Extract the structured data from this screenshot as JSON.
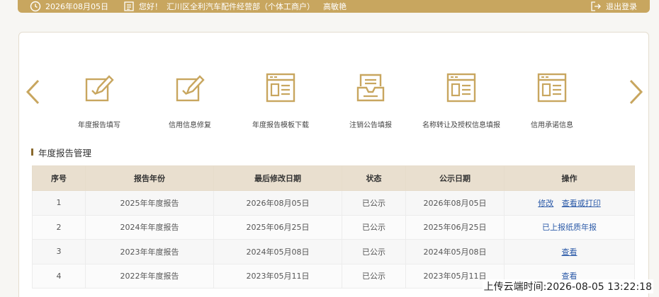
{
  "header": {
    "date": "2026年08月05日",
    "greeting": "您好！",
    "company": "汇川区全利汽车配件经营部（个体工商户）",
    "user": "高敏艳",
    "logout_label": "退出登录"
  },
  "functions": [
    {
      "label": "年度报告填写",
      "icon": "report-edit-icon"
    },
    {
      "label": "信用信息修复",
      "icon": "credit-repair-icon"
    },
    {
      "label": "年度报告模板下载",
      "icon": "template-download-icon"
    },
    {
      "label": "注销公告填报",
      "icon": "cancel-notice-icon"
    },
    {
      "label": "名称转让及授权信息填报",
      "icon": "name-transfer-icon"
    },
    {
      "label": "信用承诺信息",
      "icon": "credit-promise-icon"
    }
  ],
  "section": {
    "title": "年度报告管理"
  },
  "table": {
    "headers": [
      "序号",
      "报告年份",
      "最后修改日期",
      "状态",
      "公示日期",
      "操作"
    ],
    "rows": [
      {
        "no": "1",
        "year": "2025年年度报告",
        "modified": "2026年08月05日",
        "status": "已公示",
        "published": "2026年08月05日",
        "actions": [
          "修改",
          "查看或打印"
        ]
      },
      {
        "no": "2",
        "year": "2024年年度报告",
        "modified": "2025年06月25日",
        "status": "已公示",
        "published": "2025年06月25日",
        "actions": [
          "已上报纸质年报"
        ]
      },
      {
        "no": "3",
        "year": "2023年年度报告",
        "modified": "2024年05月08日",
        "status": "已公示",
        "published": "2024年05月08日",
        "actions": [
          "查看"
        ]
      },
      {
        "no": "4",
        "year": "2022年年度报告",
        "modified": "2023年05月11日",
        "status": "已公示",
        "published": "2023年05月11日",
        "actions": [
          "查看"
        ]
      }
    ]
  },
  "upload_time": "上传云端时间:2026-08-05 13:22:18",
  "colors": {
    "gold": "#c8a65f",
    "link": "#2b5aa8",
    "header_bg": "#e9dfcf"
  }
}
